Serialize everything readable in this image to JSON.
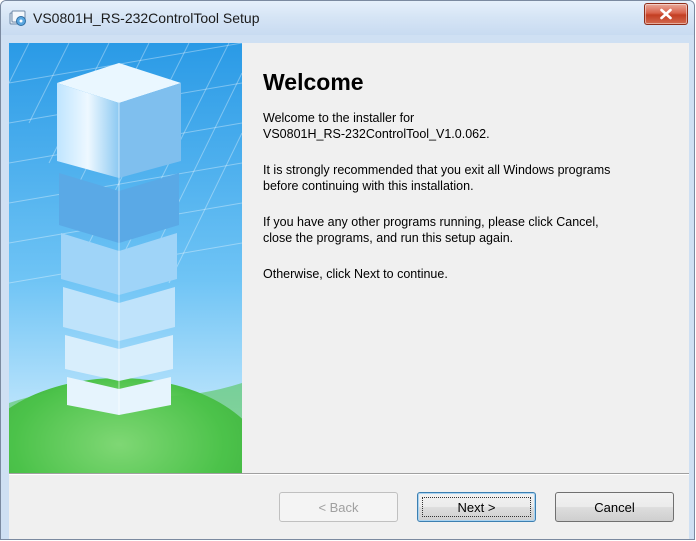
{
  "window": {
    "title": "VS0801H_RS-232ControlTool Setup",
    "app_icon": "installer-icon",
    "close_icon": "close-icon",
    "close_color": "#c7432a"
  },
  "welcome": {
    "heading": "Welcome",
    "paragraphs": [
      [
        "Welcome to the installer for",
        "VS0801H_RS-232ControlTool_V1.0.062."
      ],
      [
        "It is strongly recommended that you exit all Windows programs",
        "before continuing with this installation."
      ],
      [
        "If you have any other programs running, please click Cancel,",
        "close the programs, and run this setup again."
      ],
      [
        "Otherwise, click Next to continue."
      ]
    ]
  },
  "banner": {
    "image": "tower-globe-graphic",
    "colors": {
      "sky": "#1e8bd8",
      "tower": "#cfeaff",
      "globe": "#4cc24a"
    }
  },
  "buttons": {
    "back": {
      "label": "< Back",
      "enabled": false
    },
    "next": {
      "label": "Next >",
      "enabled": true,
      "default": true
    },
    "cancel": {
      "label": "Cancel",
      "enabled": true
    }
  }
}
